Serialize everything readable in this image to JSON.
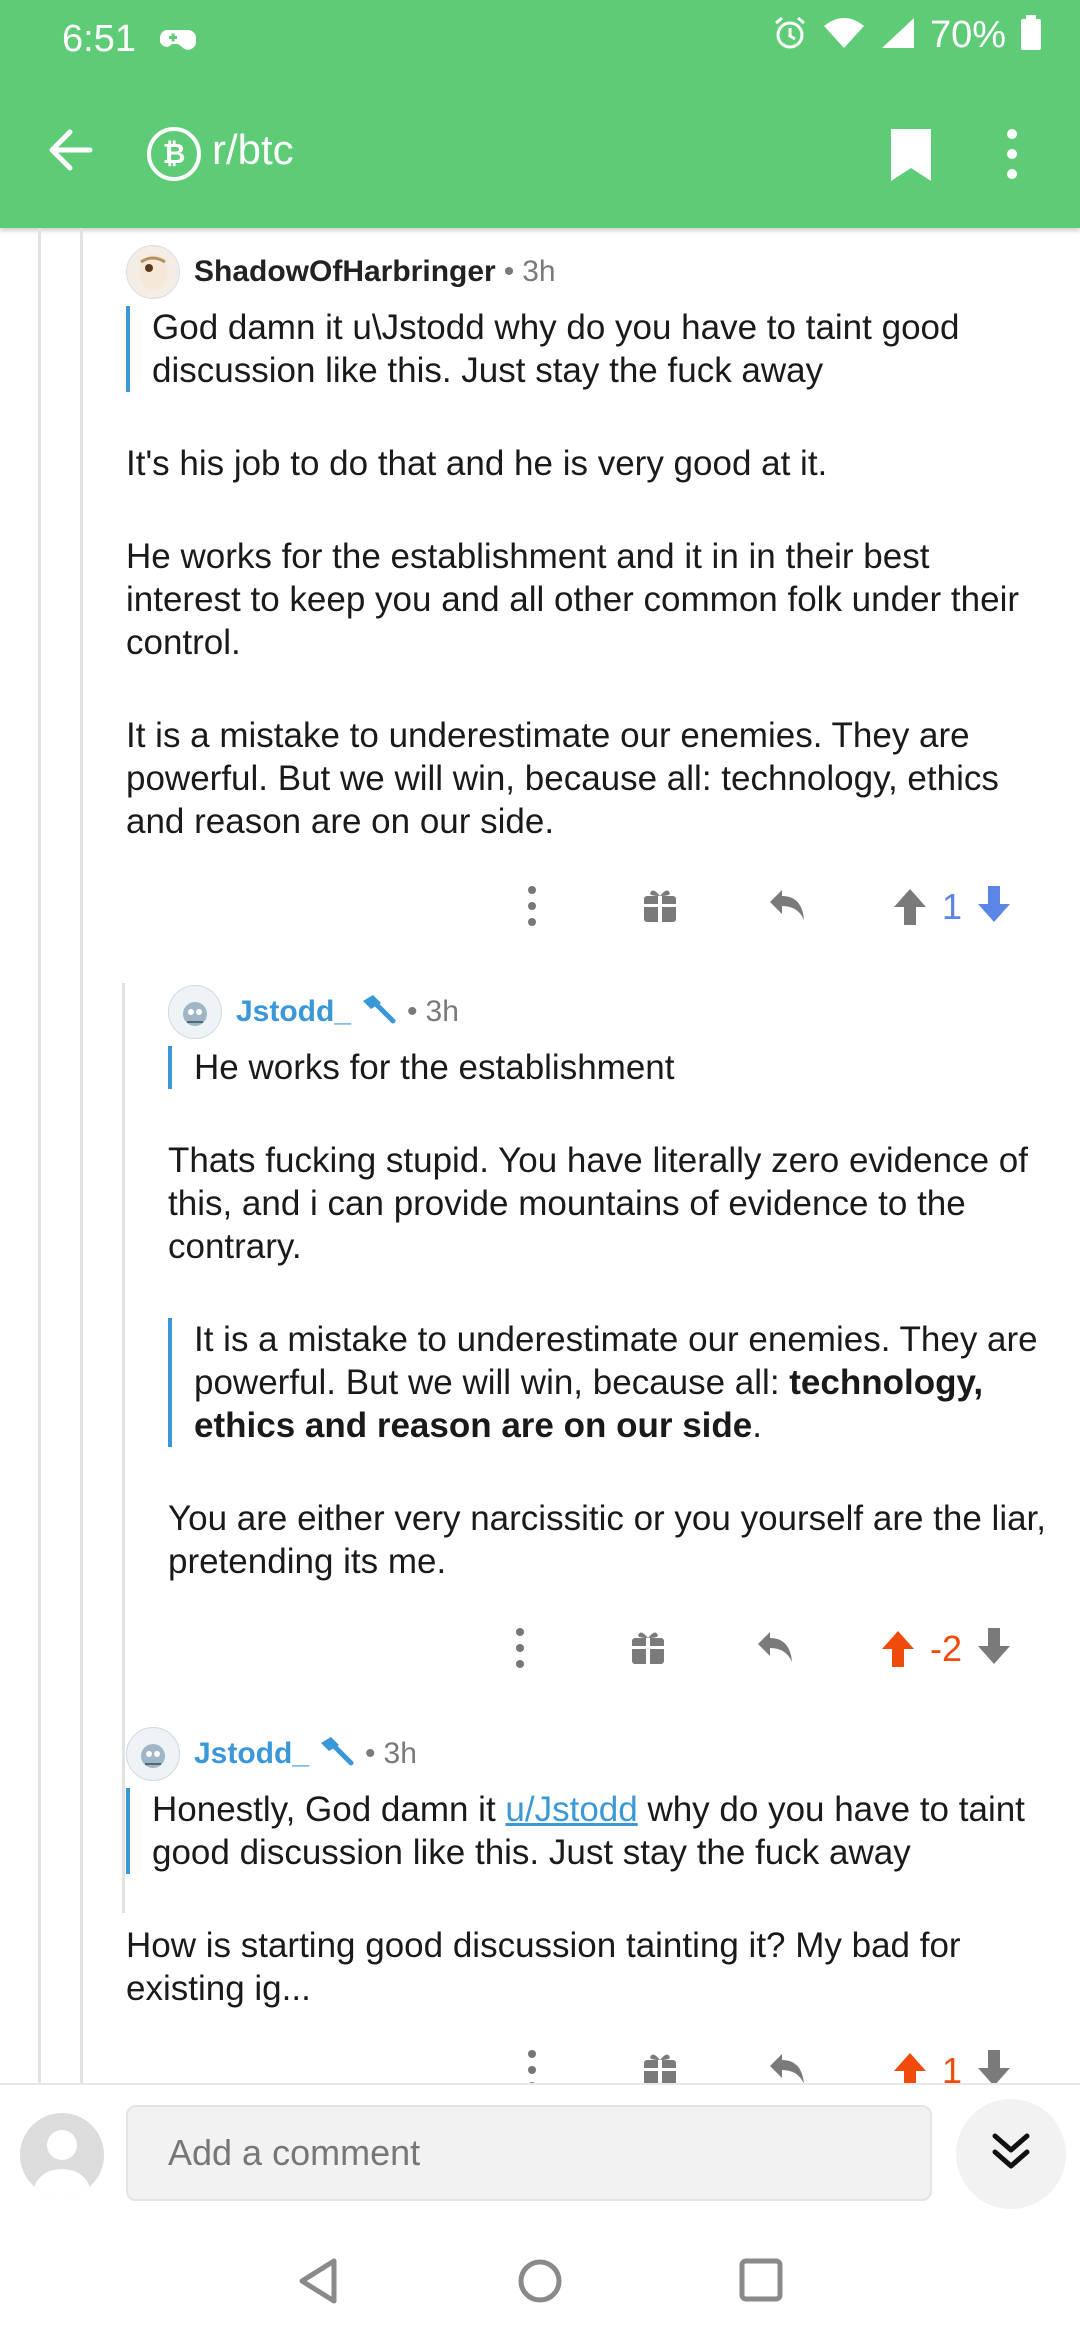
{
  "status_bar": {
    "time": "6:51",
    "battery": "70%"
  },
  "app_bar": {
    "title": "r/btc",
    "back_icon": "arrow-left-icon",
    "bookmark_icon": "bookmark-icon",
    "more_icon": "more-vertical-icon"
  },
  "colors": {
    "brand_green": "#5ecc77",
    "mod_blue": "#3a97d8",
    "upvote_orange": "#f04b0b",
    "downvote_blue": "#5b86e5"
  },
  "comments": [
    {
      "author": "ShadowOfHarbringer",
      "age": "3h",
      "quote": "God damn it u\\Jstodd why do you have to taint good discussion like this. Just stay the fuck away",
      "paragraphs": [
        "It's his job to do that and he is very good at it.",
        "He works for the establishment and it in in their best interest to keep you and all other common folk under their control.",
        "It is a mistake to underestimate our enemies. They are powerful. But we will win, because all: technology, ethics and reason are on our side."
      ],
      "score": "1"
    },
    {
      "author": "Jstodd_",
      "age": "3h",
      "quote": "He works for the establishment",
      "paragraph1": "Thats fucking stupid. You have literally zero evidence of this, and i can provide mountains of evidence to the contrary.",
      "quote2_plain": "It is a mistake to underestimate our enemies. They are powerful. But we will win, because all: ",
      "quote2_bold": "technology, ethics and reason are on our side",
      "quote2_end": ".",
      "paragraph2": "You are either very narcissitic or you yourself are the liar, pretending its me.",
      "score": "-2"
    },
    {
      "author": "Jstodd_",
      "age": "3h",
      "quote_pre": "Honestly, God damn it ",
      "quote_link": "u/Jstodd",
      "quote_post": " why do you have to taint good discussion like this. Just stay the fuck away",
      "paragraph": "How is starting good discussion tainting it? My bad for existing ig...",
      "score": "1"
    }
  ],
  "composer": {
    "placeholder": "Add a comment"
  }
}
